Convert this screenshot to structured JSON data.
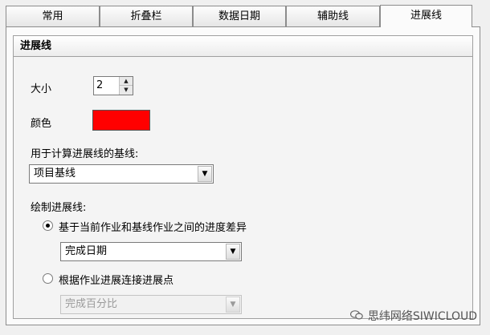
{
  "tabs": [
    {
      "label": "常用"
    },
    {
      "label": "折叠栏"
    },
    {
      "label": "数据日期"
    },
    {
      "label": "辅助线"
    },
    {
      "label": "进展线",
      "active": true
    }
  ],
  "section": {
    "title": "进展线"
  },
  "size": {
    "label": "大小",
    "value": "2"
  },
  "color": {
    "label": "颜色",
    "value": "#ff0000"
  },
  "baseline": {
    "label": "用于计算进展线的基线:",
    "selected": "项目基线"
  },
  "draw": {
    "label": "绘制进展线:",
    "option1": {
      "label": "基于当前作业和基线作业之间的进度差异",
      "checked": true,
      "combo": "完成日期"
    },
    "option2": {
      "label": "根据作业进展连接进展点",
      "checked": false,
      "combo": "完成百分比"
    }
  },
  "watermark": {
    "text": "思纬网络SIWICLOUD",
    "icon": "wechat-icon"
  }
}
